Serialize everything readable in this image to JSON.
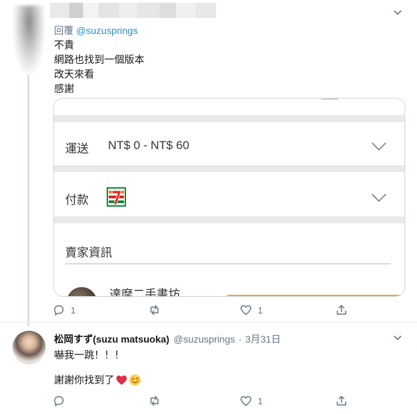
{
  "tweet1": {
    "reply_prefix": "回覆",
    "reply_handle": "@suzusprings",
    "lines": [
      "不貴",
      "網路也找到一個版本",
      "改天來看",
      "感謝"
    ],
    "card": {
      "shipping_label": "運送",
      "shipping_value": "NT$ 0 - NT$ 60",
      "payment_label": "付款",
      "seller_label": "賣家資訊",
      "shop_name": "達摩二手書坊"
    },
    "actions": {
      "reply_count": "1",
      "retweet_count": "",
      "like_count": "1"
    }
  },
  "tweet2": {
    "name": "松岡すず(suzu matsuoka)",
    "handle": "@suzusprings",
    "date": "3月31日",
    "line1": "嚇我一跳！！！",
    "line2": "謝謝你找到了",
    "actions": {
      "reply_count": "",
      "retweet_count": "",
      "like_count": "1"
    }
  },
  "icons": {
    "caret": "chevron-down-icon",
    "reply": "reply-icon",
    "retweet": "retweet-icon",
    "like": "heart-icon",
    "share": "share-icon",
    "payment": "seven-eleven-logo",
    "emoji1": "red-heart-emoji",
    "emoji2": "smiling-face-emoji"
  },
  "colors": {
    "link": "#1b95e0",
    "muted": "#657786",
    "accent_bar": "#f2a640"
  }
}
